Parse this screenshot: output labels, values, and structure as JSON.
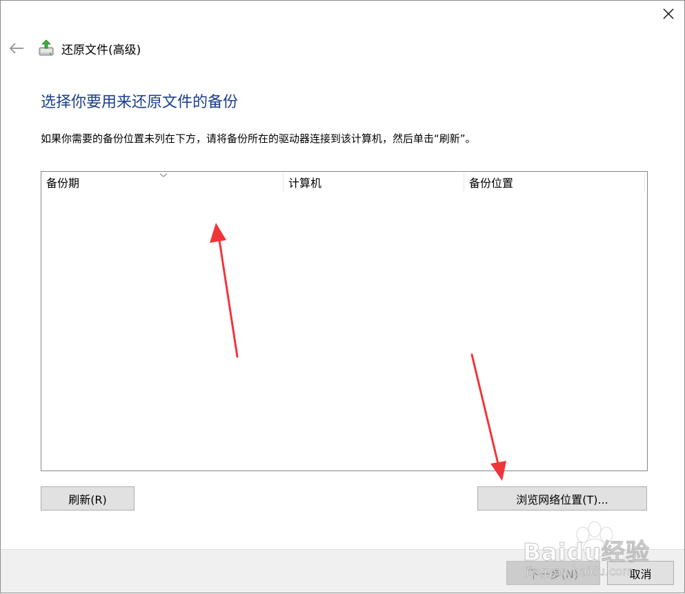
{
  "window": {
    "title": "还原文件(高级)",
    "close_icon": "close-icon",
    "back_icon": "back-arrow-icon",
    "app_icon": "restore-files-icon"
  },
  "main": {
    "heading": "选择你要用来还原文件的备份",
    "description": "如果你需要的备份位置未列在下方，请将备份所在的驱动器连接到该计算机，然后单击“刷新”。"
  },
  "backup_list": {
    "columns": [
      {
        "label": "备份期",
        "sorted": true
      },
      {
        "label": "计算机"
      },
      {
        "label": "备份位置"
      }
    ],
    "rows": []
  },
  "buttons": {
    "refresh": "刷新(R)",
    "browse_network": "浏览网络位置(T)...",
    "next": "下一步(N)",
    "cancel": "取消"
  },
  "colors": {
    "heading": "#1a3e8c",
    "annotation_arrow": "#f0353a"
  },
  "watermark": {
    "brand": "Baidu经验",
    "site": "jingyan.baidu.com"
  }
}
